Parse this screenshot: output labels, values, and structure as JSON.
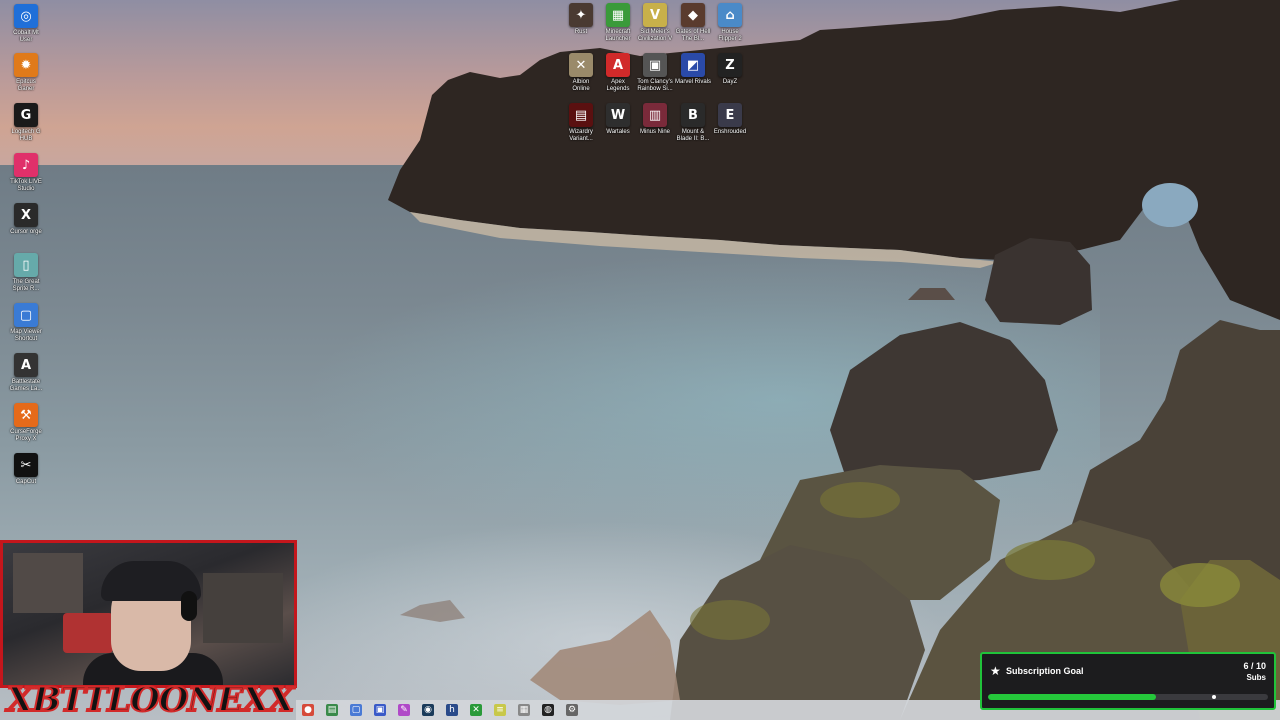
{
  "desktop": {
    "left_icons": [
      {
        "label": "Cobalt Mt\nUser",
        "icon": "globe-icon",
        "color": "#1f6fd8"
      },
      {
        "label": "Epitcus\nGaner",
        "icon": "flame-icon",
        "color": "#e07a1a"
      },
      {
        "label": "Logitech G\nHUB",
        "icon": "logitech-g-icon",
        "color": "#1a1a1a"
      },
      {
        "label": "TikTok LIVE\nStudio",
        "icon": "tiktok-icon",
        "color": "#e0306a"
      },
      {
        "label": "Cursor orge",
        "icon": "game-icon",
        "color": "#2a2a2a"
      },
      {
        "label": "The Great\nSprite R...",
        "icon": "file-icon",
        "color": "#6aa"
      },
      {
        "label": "Map Viewer\nShortcut",
        "icon": "window-icon",
        "color": "#3a7bd5"
      },
      {
        "label": "Battlestate\nGames La...",
        "icon": "letter-a-icon",
        "color": "#333"
      },
      {
        "label": "CurseForge\nProxy X",
        "icon": "anvil-icon",
        "color": "#e56a1a"
      },
      {
        "label": "CapCut",
        "icon": "capcut-icon",
        "color": "#111"
      }
    ],
    "grid_icons": [
      [
        {
          "label": "Rust",
          "icon": "rust-icon",
          "color": "#4a3a32"
        },
        {
          "label": "Minecraft\nLauncher",
          "icon": "creeper-icon",
          "color": "#3a9a3a"
        },
        {
          "label": "Sid Meier's\nCivilization V",
          "icon": "letter-v-icon",
          "color": "#c8b04a"
        },
        {
          "label": "Gates of Hell\nThe Bl...",
          "icon": "soldier-icon",
          "color": "#5a3b2e"
        },
        {
          "label": "House\nFlipper 2",
          "icon": "house-icon",
          "color": "#4a8ac8"
        }
      ],
      [
        {
          "label": "Albion\nOnline",
          "icon": "albion-icon",
          "color": "#9a8a6a"
        },
        {
          "label": "Apex\nLegends",
          "icon": "apex-icon",
          "color": "#d12a2a"
        },
        {
          "label": "Tom Clancy's\nRainbow Si...",
          "icon": "r6-icon",
          "color": "#555"
        },
        {
          "label": "Marvel Rivals",
          "icon": "marvel-icon",
          "color": "#2a4aa8"
        },
        {
          "label": "DayZ",
          "icon": "dayz-icon",
          "color": "#222"
        }
      ],
      [
        {
          "label": "Wizardry\nVariant...",
          "icon": "wizardry-icon",
          "color": "#5a1010"
        },
        {
          "label": "Wartales",
          "icon": "wartales-icon",
          "color": "#2e2e2e"
        },
        {
          "label": "Minus Nine",
          "icon": "minus-nine-icon",
          "color": "#7a2a3a"
        },
        {
          "label": "Mount &\nBlade II: B...",
          "icon": "letter-b-icon",
          "color": "#2a2a2a"
        },
        {
          "label": "Enshrouded",
          "icon": "letter-e-icon",
          "color": "#3a3a4a"
        }
      ]
    ],
    "grid_glyphs": [
      [
        "✦",
        "▦",
        "V",
        "◆",
        "⌂"
      ],
      [
        "✕",
        "A",
        "▣",
        "◩",
        "Z"
      ],
      [
        "▤",
        "W",
        "▥",
        "B",
        "E"
      ]
    ],
    "left_glyphs": [
      "◎",
      "✹",
      "G",
      "♪",
      "X",
      "▯",
      "▢",
      "A",
      "⚒",
      "✂"
    ]
  },
  "webcam": {
    "overlay_name": "XBTTLOONEXX",
    "border_color": "#c4161c"
  },
  "taskbar": {
    "icons": [
      {
        "icon": "chrome-icon",
        "color": "#d64a3a",
        "glyph": "●"
      },
      {
        "icon": "files-icon",
        "color": "#3a8a4a",
        "glyph": "▤"
      },
      {
        "icon": "window-icon",
        "color": "#4a7ad5",
        "glyph": "▢"
      },
      {
        "icon": "teams-icon",
        "color": "#3a5ac8",
        "glyph": "▣"
      },
      {
        "icon": "pen-icon",
        "color": "#b04ac8",
        "glyph": "✎"
      },
      {
        "icon": "steam-icon",
        "color": "#1a3a5a",
        "glyph": "◉"
      },
      {
        "icon": "hub-icon",
        "color": "#2a4a8a",
        "glyph": "h"
      },
      {
        "icon": "xbox-icon",
        "color": "#2a9a3a",
        "glyph": "✕"
      },
      {
        "icon": "stack-icon",
        "color": "#c8c84a",
        "glyph": "≡"
      },
      {
        "icon": "frame-icon",
        "color": "#888",
        "glyph": "▦"
      },
      {
        "icon": "obs-icon",
        "color": "#222",
        "glyph": "◍"
      },
      {
        "icon": "settings-icon",
        "color": "#666",
        "glyph": "⚙"
      }
    ]
  },
  "subscription_goal": {
    "title": "Subscription Goal",
    "count": "6 / 10",
    "unit": "Subs",
    "progress": 0.6,
    "icon": "star-icon",
    "accent_color": "#20c33a"
  }
}
